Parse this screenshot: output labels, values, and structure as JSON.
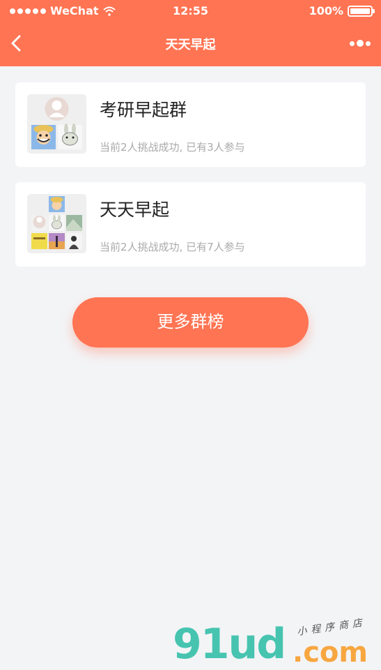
{
  "status_bar": {
    "carrier": "WeChat",
    "time": "12:55",
    "battery": "100%"
  },
  "nav": {
    "title": "天天早起",
    "back_icon": "chevron-left-icon",
    "more_icon": "more-dots-icon"
  },
  "groups": [
    {
      "name": "考研早起群",
      "summary": "当前2人挑战成功, 已有3人参与"
    },
    {
      "name": "天天早起",
      "summary": "当前2人挑战成功, 已有7人参与"
    }
  ],
  "more_button_label": "更多群榜",
  "watermark": {
    "main": "91ud",
    "suffix": ".com",
    "tagline": "小程序商店"
  },
  "colors": {
    "brand": "#ff7453",
    "background": "#f3f4f6"
  }
}
